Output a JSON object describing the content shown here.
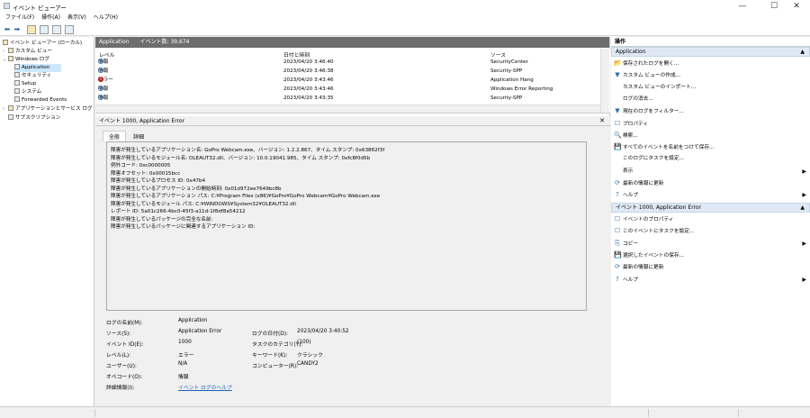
{
  "window": {
    "title": "イベント ビューアー",
    "minimize": "—",
    "maximize": "☐",
    "close": "✕"
  },
  "menu": [
    "ファイル(F)",
    "操作(A)",
    "表示(V)",
    "ヘルプ(H)"
  ],
  "tree": {
    "root": "イベント ビューアー (ローカル)",
    "custom_views": "カスタム ビュー",
    "windows_logs": "Windows ログ",
    "application": "Application",
    "security": "セキュリティ",
    "setup": "Setup",
    "system": "システム",
    "forwarded": "Forwarded Events",
    "app_service_logs": "アプリケーションとサービス ログ",
    "subscriptions": "サブスクリプション"
  },
  "list_header": {
    "name": "Application",
    "count": "イベント数: 39,674"
  },
  "columns": {
    "level": "レベル",
    "datetime": "日付と時刻",
    "source": "ソース"
  },
  "rows": [
    {
      "level": "情報",
      "type": "info",
      "datetime": "2023/04/20 3:46:40",
      "source": "SecurityCenter"
    },
    {
      "level": "情報",
      "type": "info",
      "datetime": "2023/04/20 3:46:38",
      "source": "Security-SPP"
    },
    {
      "level": "エラー",
      "type": "error",
      "datetime": "2023/04/20 3:43:46",
      "source": "Application Hang"
    },
    {
      "level": "情報",
      "type": "info",
      "datetime": "2023/04/20 3:43:46",
      "source": "Windows Error Reporting"
    },
    {
      "level": "情報",
      "type": "info",
      "datetime": "2023/04/20 3:43:35",
      "source": "Security-SPP"
    }
  ],
  "detail": {
    "title": "イベント 1000, Application Error",
    "tab_general": "全般",
    "tab_details": "詳細",
    "description": [
      "障害が発生しているアプリケーション名: GoPro Webcam.exe、バージョン: 1.2.2.867、タイム スタンプ: 0x63862f3f",
      "障害が発生しているモジュール名: OLEAUT32.dll、バージョン: 10.0.19041.985、タイム スタンプ: 0xfc8f0d5b",
      "例外コード: 0xc0000005",
      "障害オフセット: 0x00015bcc",
      "障害が発生しているプロセス ID: 0x47b4",
      "障害が発生しているアプリケーションの開始時刻: 0x01d972ee7649bc8b",
      "障害が発生しているアプリケーション パス: C:¥Program Files (x86)¥GoPro¥GoPro Webcam¥GoPro Webcam.exe",
      "障害が発生しているモジュール パス: C:¥WINDOWS¥System32¥OLEAUT32.dll",
      "レポート ID: 5a01c266-4bc0-45f3-a11d-1f8df8a54212",
      "障害が発生しているパッケージの完全な名前:",
      "障害が発生しているパッケージに関連するアプリケーション ID:"
    ],
    "props": {
      "log_name_label": "ログの名前(M):",
      "log_name": "Application",
      "source_label": "ソース(S):",
      "source": "Application Error",
      "logged_label": "ログの日付(D):",
      "logged": "2023/04/20 3:40:52",
      "event_id_label": "イベント ID(E):",
      "event_id": "1000",
      "task_label": "タスクのカテゴリ(Y):",
      "task": "(100)",
      "level_label": "レベル(L):",
      "level": "エラー",
      "keywords_label": "キーワード(K):",
      "keywords": "クラシック",
      "user_label": "ユーザー(U):",
      "user": "N/A",
      "computer_label": "コンピューター(R):",
      "computer": "CANDY2",
      "opcode_label": "オペコード(O):",
      "opcode": "情報",
      "more_info_label": "詳細情報(I):",
      "more_info": "イベント ログのヘルプ"
    }
  },
  "actions": {
    "header": "操作",
    "section1": "Application",
    "items1": [
      {
        "icon": "📂",
        "label": "保存されたログを開く..."
      },
      {
        "icon": "▼",
        "label": "カスタム ビューの作成..."
      },
      {
        "icon": "",
        "label": "カスタム ビューのインポート..."
      },
      {
        "icon": "",
        "label": "ログの消去..."
      },
      {
        "icon": "▼",
        "label": "現在のログをフィルター..."
      },
      {
        "icon": "☐",
        "label": "プロパティ"
      },
      {
        "icon": "🔍",
        "label": "検索..."
      },
      {
        "icon": "💾",
        "label": "すべてのイベントを名前をつけて保存..."
      },
      {
        "icon": "",
        "label": "このログにタスクを設定..."
      },
      {
        "icon": "",
        "label": "表示",
        "sub": "▶"
      },
      {
        "icon": "⟳",
        "label": "最新の情報に更新"
      },
      {
        "icon": "?",
        "label": "ヘルプ",
        "sub": "▶"
      }
    ],
    "section2": "イベント 1000, Application Error",
    "items2": [
      {
        "icon": "☐",
        "label": "イベントのプロパティ"
      },
      {
        "icon": "☐",
        "label": "このイベントにタスクを設定..."
      },
      {
        "icon": "⎘",
        "label": "コピー",
        "sub": "▶"
      },
      {
        "icon": "💾",
        "label": "選択したイベントの保存..."
      },
      {
        "icon": "⟳",
        "label": "最新の情報に更新"
      },
      {
        "icon": "?",
        "label": "ヘルプ",
        "sub": "▶"
      }
    ]
  }
}
